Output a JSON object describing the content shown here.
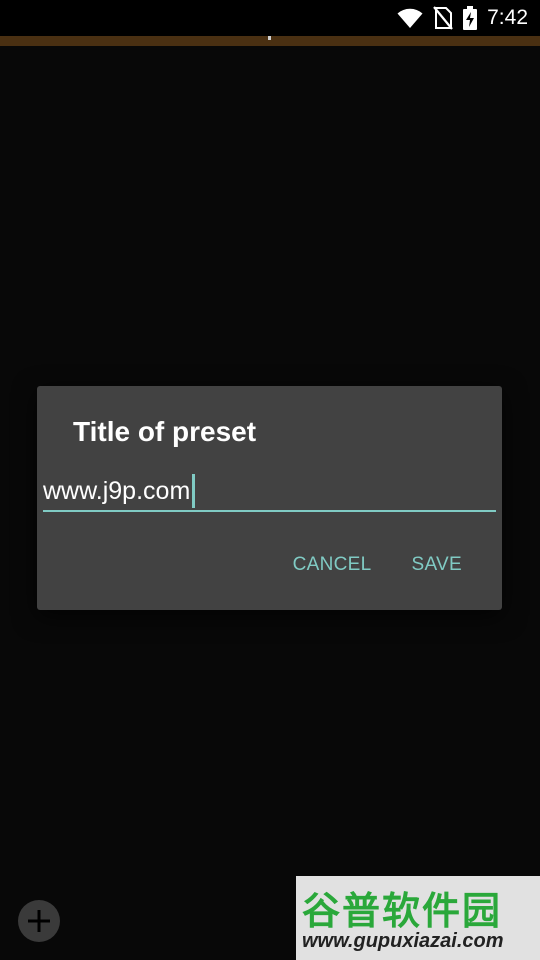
{
  "status_bar": {
    "time": "7:42",
    "icons": [
      "wifi-icon",
      "no-sim-icon",
      "battery-charging-icon"
    ]
  },
  "dialog": {
    "title": "Title of preset",
    "input_value": "www.j9p.com",
    "cancel_label": "CANCEL",
    "save_label": "SAVE"
  },
  "fab": {
    "icon": "add-icon"
  },
  "watermark": {
    "brand": "谷普软件园",
    "url": "www.gupuxiazai.com"
  },
  "colors": {
    "accent": "#80cbc4",
    "dialog_bg": "#424242",
    "background": "#0b0b0b",
    "strip": "#4a3012"
  }
}
